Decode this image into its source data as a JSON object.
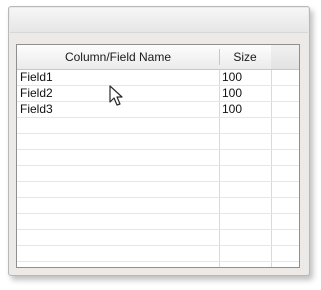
{
  "grid": {
    "columns": [
      {
        "label": "Column/Field Name"
      },
      {
        "label": "Size"
      },
      {
        "label": ""
      }
    ],
    "rows": [
      {
        "name": "Field1",
        "size": "100"
      },
      {
        "name": "Field2",
        "size": "100"
      },
      {
        "name": "Field3",
        "size": "100"
      },
      {
        "name": "",
        "size": ""
      },
      {
        "name": "",
        "size": ""
      },
      {
        "name": "",
        "size": ""
      },
      {
        "name": "",
        "size": ""
      },
      {
        "name": "",
        "size": ""
      },
      {
        "name": "",
        "size": ""
      },
      {
        "name": "",
        "size": ""
      },
      {
        "name": "",
        "size": ""
      },
      {
        "name": "",
        "size": ""
      }
    ]
  },
  "icons": {
    "cursor": "mouse-pointer-icon"
  },
  "colors": {
    "panel_bg": "#ece9e6",
    "grid_border": "#8f8f8f",
    "row_line": "#e6e6e6"
  }
}
